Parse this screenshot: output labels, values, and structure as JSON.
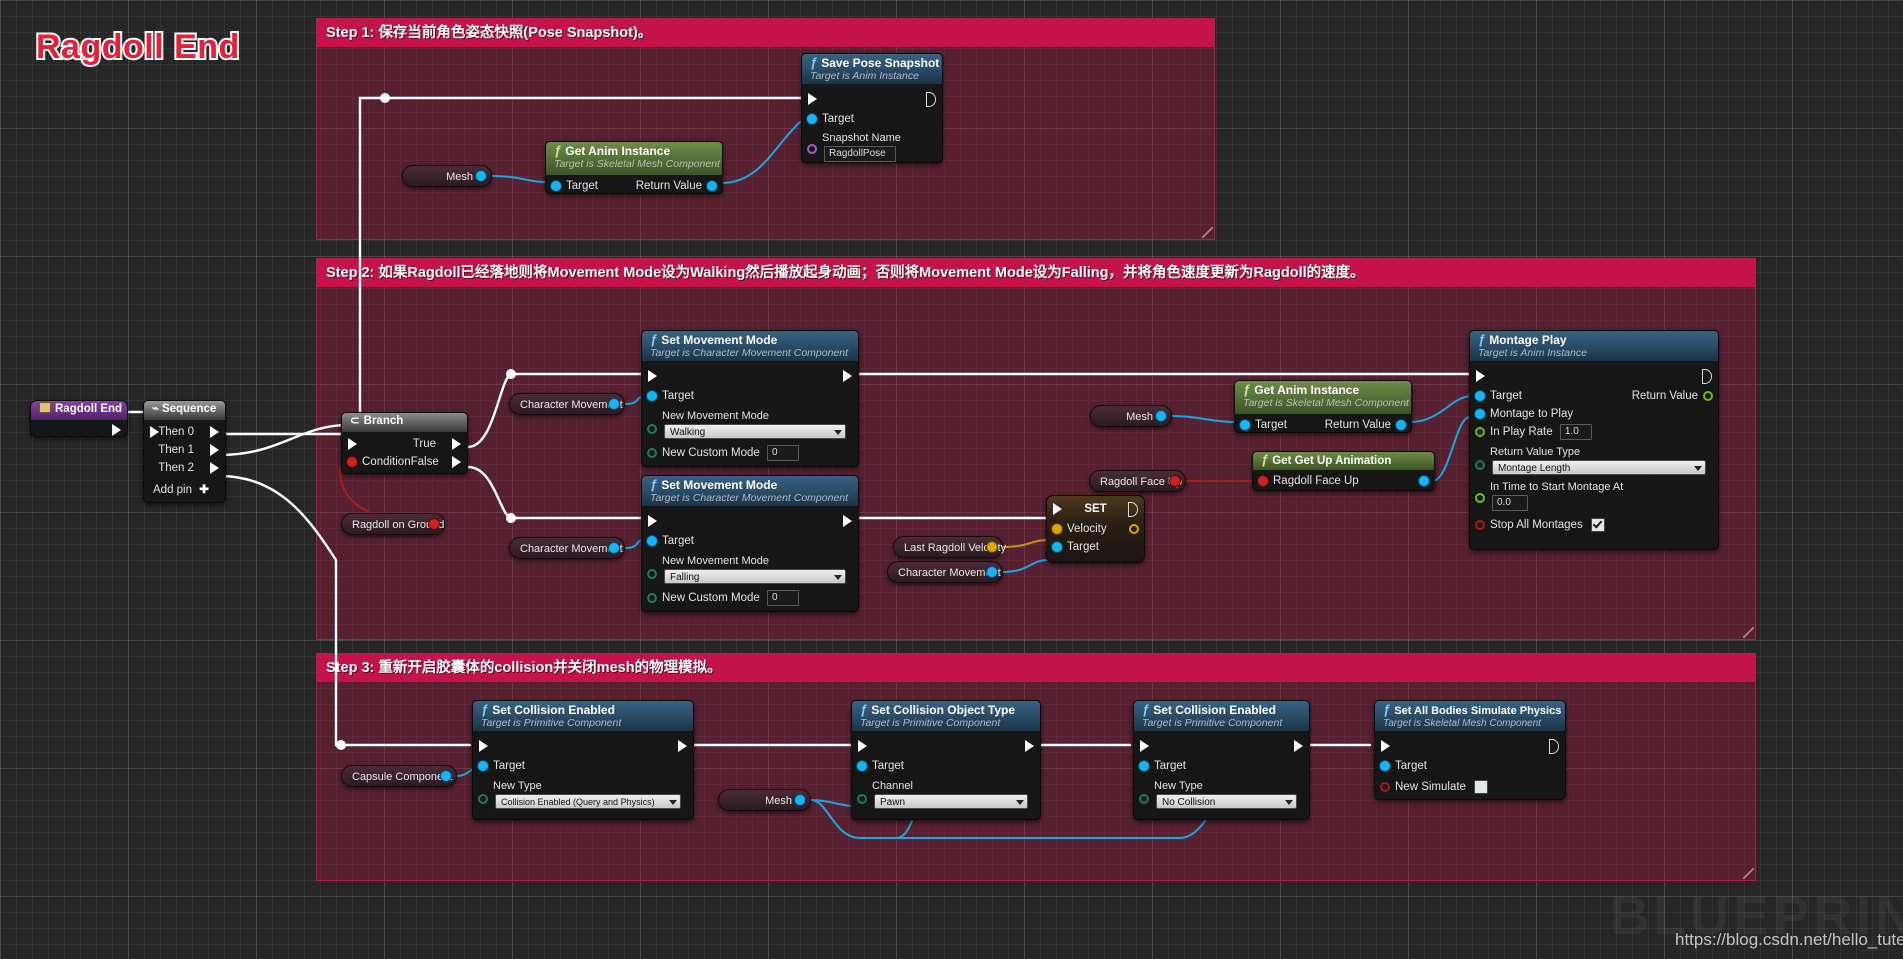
{
  "canvas": {
    "title": "Ragdoll End",
    "watermark": "BLUEPRINT",
    "url": "https://blog.csdn.net/hello_tute",
    "accent_comment": "#c4134a",
    "background": "#262626"
  },
  "comments": [
    {
      "id": "step1",
      "label": "Step 1: 保存当前角色姿态快照(Pose Snapshot)。"
    },
    {
      "id": "step2",
      "label": "Step 2: 如果Ragdoll已经落地则将Movement Mode设为Walking然后播放起身动画；否则将Movement Mode设为Falling，并将角色速度更新为Ragdoll的速度。"
    },
    {
      "id": "step3",
      "label": "Step 3: 重新开启胶囊体的collision并关闭mesh的物理模拟。"
    }
  ],
  "nodes": {
    "ragdoll_end_event": {
      "title": "Ragdoll End"
    },
    "sequence": {
      "title": "Sequence",
      "then0": "Then 0",
      "then1": "Then 1",
      "then2": "Then 2",
      "addpin": "Add pin"
    },
    "branch": {
      "title": "Branch",
      "condition": "Condition",
      "true": "True",
      "false": "False"
    },
    "save_pose_snapshot": {
      "title": "Save Pose Snapshot",
      "subtitle": "Target is Anim Instance",
      "target": "Target",
      "snapshot_name_label": "Snapshot Name",
      "snapshot_name_value": "RagdollPose"
    },
    "get_anim_instance_1": {
      "title": "Get Anim Instance",
      "subtitle": "Target is Skeletal Mesh Component",
      "target": "Target",
      "return_value": "Return Value"
    },
    "get_anim_instance_2": {
      "title": "Get Anim Instance",
      "subtitle": "Target is Skeletal Mesh Component",
      "target": "Target",
      "return_value": "Return Value"
    },
    "set_movement_mode_walking": {
      "title": "Set Movement Mode",
      "subtitle": "Target is Character Movement Component",
      "target": "Target",
      "new_movement_mode_label": "New Movement Mode",
      "new_movement_mode_value": "Walking",
      "new_custom_mode_label": "New Custom Mode",
      "new_custom_mode_value": "0"
    },
    "set_movement_mode_falling": {
      "title": "Set Movement Mode",
      "subtitle": "Target is Character Movement Component",
      "target": "Target",
      "new_movement_mode_label": "New Movement Mode",
      "new_movement_mode_value": "Falling",
      "new_custom_mode_label": "New Custom Mode",
      "new_custom_mode_value": "0"
    },
    "set_velocity": {
      "title": "SET",
      "velocity": "Velocity",
      "target": "Target"
    },
    "get_get_up_animation": {
      "title": "Get Get Up Animation",
      "ragdoll_face_up": "Ragdoll Face Up",
      "return_value": "Return Value"
    },
    "montage_play": {
      "title": "Montage Play",
      "subtitle": "Target is Anim Instance",
      "target": "Target",
      "return_value": "Return Value",
      "montage_to_play": "Montage to Play",
      "in_play_rate_label": "In Play Rate",
      "in_play_rate_value": "1.0",
      "return_value_type_label": "Return Value Type",
      "return_value_type_value": "Montage Length",
      "in_time_label": "In Time to Start Montage At",
      "in_time_value": "0.0",
      "stop_all_montages": "Stop All Montages",
      "stop_all_montages_checked": true
    },
    "set_collision_enabled_1": {
      "title": "Set Collision Enabled",
      "subtitle": "Target is Primitive Component",
      "target": "Target",
      "new_type_label": "New Type",
      "new_type_value": "Collision Enabled (Query and Physics)"
    },
    "set_collision_object_type": {
      "title": "Set Collision Object Type",
      "subtitle": "Target is Primitive Component",
      "target": "Target",
      "channel_label": "Channel",
      "channel_value": "Pawn"
    },
    "set_collision_enabled_2": {
      "title": "Set Collision Enabled",
      "subtitle": "Target is Primitive Component",
      "target": "Target",
      "new_type_label": "New Type",
      "new_type_value": "No Collision"
    },
    "set_all_bodies_simulate_physics": {
      "title": "Set All Bodies Simulate Physics",
      "subtitle": "Target is Skeletal Mesh Component",
      "target": "Target",
      "new_simulate_label": "New Simulate",
      "new_simulate_checked": false
    }
  },
  "variables": {
    "mesh_1": "Mesh",
    "mesh_2": "Mesh",
    "mesh_3": "Mesh",
    "ragdoll_on_ground": "Ragdoll on Ground",
    "character_movement_1": "Character Movement",
    "character_movement_2": "Character Movement",
    "character_movement_3": "Character Movement",
    "last_ragdoll_velocity": "Last Ragdoll Velocity",
    "ragdoll_face_up": "Ragdoll Face Up",
    "capsule_component": "Capsule Component"
  }
}
